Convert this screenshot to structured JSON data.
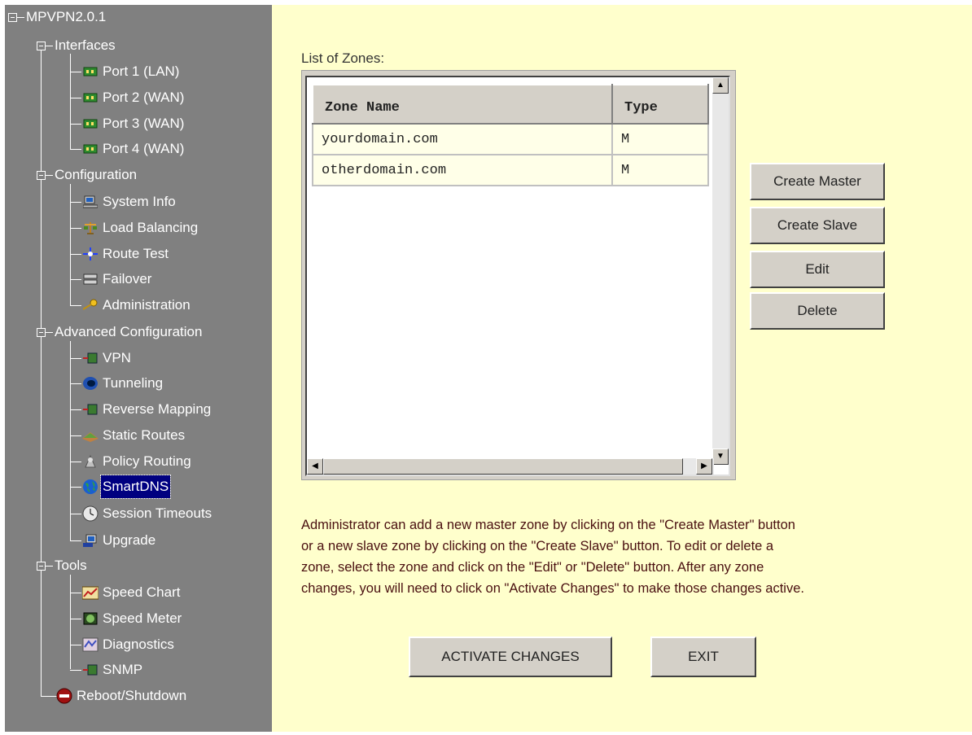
{
  "tree": {
    "root": "MPVPN2.0.1",
    "interfaces": {
      "label": "Interfaces",
      "items": [
        "Port 1 (LAN)",
        "Port 2 (WAN)",
        "Port 3 (WAN)",
        "Port 4 (WAN)"
      ]
    },
    "configuration": {
      "label": "Configuration",
      "items": [
        "System Info",
        "Load Balancing",
        "Route Test",
        "Failover",
        "Administration"
      ]
    },
    "advanced": {
      "label": "Advanced Configuration",
      "items": [
        "VPN",
        "Tunneling",
        "Reverse Mapping",
        "Static Routes",
        "Policy Routing",
        "SmartDNS",
        "Session Timeouts",
        "Upgrade"
      ],
      "selected": "SmartDNS"
    },
    "tools": {
      "label": "Tools",
      "items": [
        "Speed Chart",
        "Speed Meter",
        "Diagnostics",
        "SNMP"
      ]
    },
    "reboot": "Reboot/Shutdown"
  },
  "main": {
    "list_caption": "List of Zones:",
    "columns": [
      "Zone Name",
      "Type"
    ],
    "zones": [
      {
        "name": "yourdomain.com",
        "type": "M"
      },
      {
        "name": "otherdomain.com",
        "type": "M"
      }
    ],
    "buttons": {
      "create_master": "Create Master",
      "create_slave": "Create Slave",
      "edit": "Edit",
      "delete": "Delete",
      "activate": "ACTIVATE CHANGES",
      "exit": "EXIT"
    },
    "help_lines": [
      "Administrator can add a new master zone by clicking on the \"Create Master\" button",
      "or a new slave zone by clicking on the \"Create Slave\" button. To edit or delete a",
      "zone, select the zone and click on the \"Edit\" or \"Delete\" button. After any zone",
      "changes, you will need to click on \"Activate Changes\" to make those changes active."
    ]
  },
  "colors": {
    "sidebar_bg": "#808080",
    "main_bg": "#ffffcc",
    "selection": "#000080"
  }
}
